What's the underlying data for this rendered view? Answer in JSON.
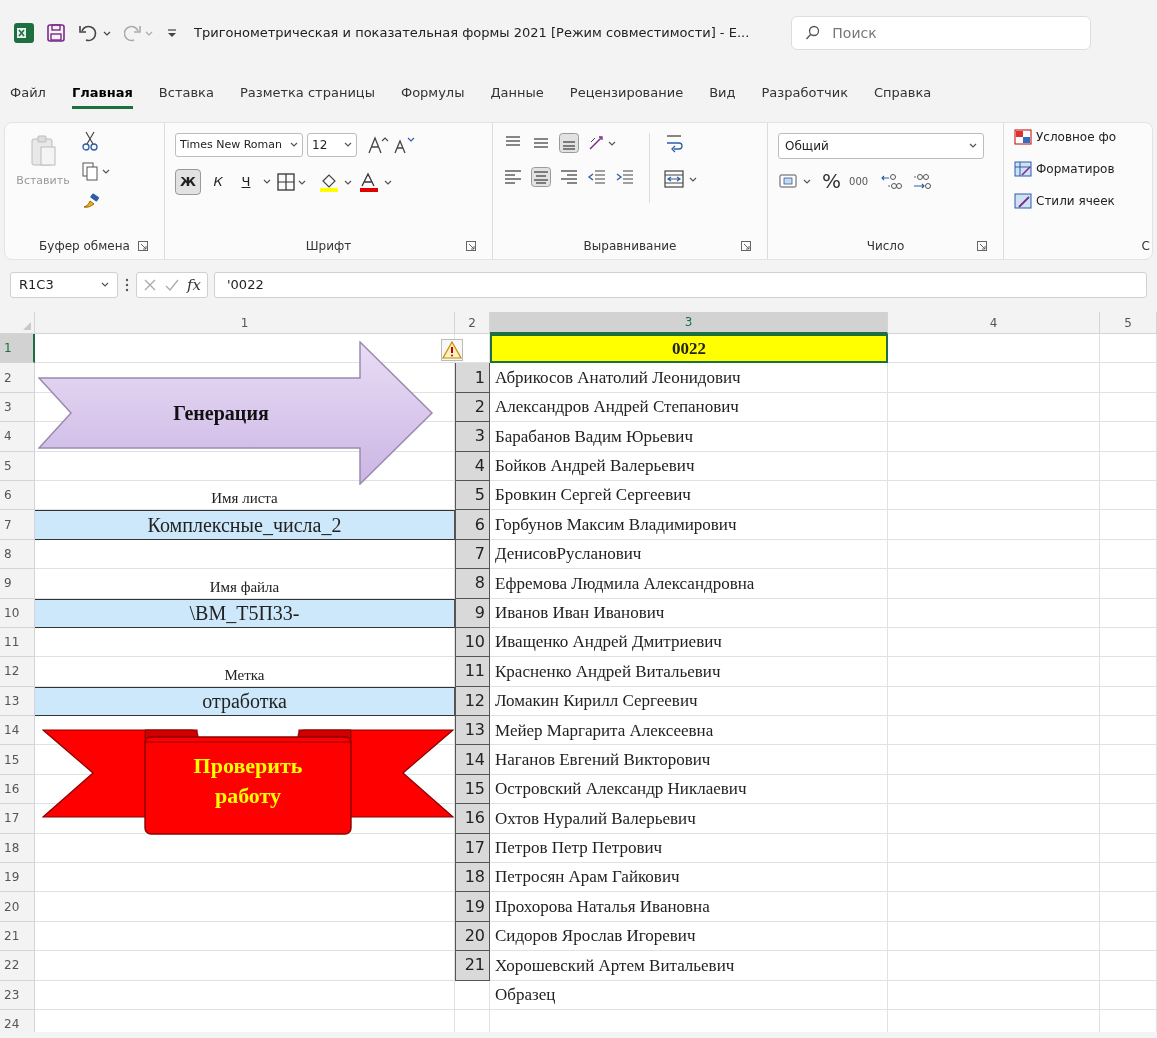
{
  "title_bar": {
    "title": "Тригонометрическая и показательная формы 2021  [Режим совместимости]  -  E...",
    "search_placeholder": "Поиск"
  },
  "ribbon_tabs": [
    {
      "label": "Файл",
      "selected": false
    },
    {
      "label": "Главная",
      "selected": true
    },
    {
      "label": "Вставка",
      "selected": false
    },
    {
      "label": "Разметка страницы",
      "selected": false
    },
    {
      "label": "Формулы",
      "selected": false
    },
    {
      "label": "Данные",
      "selected": false
    },
    {
      "label": "Рецензирование",
      "selected": false
    },
    {
      "label": "Вид",
      "selected": false
    },
    {
      "label": "Разработчик",
      "selected": false
    },
    {
      "label": "Справка",
      "selected": false
    }
  ],
  "ribbon": {
    "paste_label": "Вставить",
    "font_name": "Times New Roman",
    "font_size": "12",
    "bold_label": "Ж",
    "italic_label": "К",
    "underline_label": "Ч",
    "number_format": "Общий",
    "percent_label": "%",
    "thousands_label": "000",
    "style_buttons": [
      "Условное фо",
      "Форматиров",
      "Стили ячеек"
    ],
    "group_labels": [
      "Буфер обмена",
      "Шрифт",
      "Выравнивание",
      "Число",
      "С"
    ]
  },
  "formula_bar": {
    "name_box": "R1C3",
    "fx_label": "fx",
    "formula": "'0022"
  },
  "columns": [
    {
      "label": "1",
      "selected": false
    },
    {
      "label": "2",
      "selected": false
    },
    {
      "label": "3",
      "selected": true
    },
    {
      "label": "4",
      "selected": false
    },
    {
      "label": "5",
      "selected": false
    }
  ],
  "rows": [
    "1",
    "2",
    "3",
    "4",
    "5",
    "6",
    "7",
    "8",
    "9",
    "10",
    "11",
    "12",
    "13",
    "14",
    "15",
    "16",
    "17",
    "18",
    "19",
    "20",
    "21",
    "22",
    "23",
    "24"
  ],
  "form": [
    {
      "kind": "empty"
    },
    {
      "kind": "empty"
    },
    {
      "kind": "empty"
    },
    {
      "kind": "empty"
    },
    {
      "kind": "empty"
    },
    {
      "kind": "label",
      "text": "Имя листа"
    },
    {
      "kind": "value",
      "text": "Комплексные_числа_2"
    },
    {
      "kind": "empty"
    },
    {
      "kind": "label",
      "text": "Имя файла"
    },
    {
      "kind": "value",
      "text": "\\ВМ_Т5П33-"
    },
    {
      "kind": "empty"
    },
    {
      "kind": "label",
      "text": "Метка"
    },
    {
      "kind": "value",
      "text": "отработка"
    }
  ],
  "code_cell": {
    "text": "0022",
    "selected": true
  },
  "students": [
    {
      "number": "1",
      "name": "Абрикосов Анатолий Леонидович"
    },
    {
      "number": "2",
      "name": "Александров Андрей Степанович"
    },
    {
      "number": "3",
      "name": "Барабанов Вадим Юрьевич"
    },
    {
      "number": "4",
      "name": "Бойков Андрей Валерьевич"
    },
    {
      "number": "5",
      "name": "Бровкин Сергей Сергеевич"
    },
    {
      "number": "6",
      "name": "Горбунов Максим Владимирович"
    },
    {
      "number": "7",
      "name": "ДенисовРусланович"
    },
    {
      "number": "8",
      "name": "Ефремова Людмила Александровна"
    },
    {
      "number": "9",
      "name": "Иванов Иван Иванович"
    },
    {
      "number": "10",
      "name": "Иващенко Андрей Дмитриевич"
    },
    {
      "number": "11",
      "name": "Красненко Андрей Витальевич"
    },
    {
      "number": "12",
      "name": "Ломакин Кирилл Сергеевич"
    },
    {
      "number": "13",
      "name": "Мейер Маргарита Алексеевна"
    },
    {
      "number": "14",
      "name": "Наганов Евгений Викторович"
    },
    {
      "number": "15",
      "name": "Островский Александр Никлаевич"
    },
    {
      "number": "16",
      "name": "Охтов Нуралий Валерьевич"
    },
    {
      "number": "17",
      "name": "Петров Петр Петрович"
    },
    {
      "number": "18",
      "name": "Петросян Арам Гайкович"
    },
    {
      "number": "19",
      "name": "Прохорова Наталья Ивановна"
    },
    {
      "number": "20",
      "name": "Сидоров Ярослав Игоревич"
    },
    {
      "number": "21",
      "name": "Хорошевский Артем Витальевич"
    }
  ],
  "sample_label": "Образец",
  "shapes": {
    "generate_button": "Генерация",
    "check_button_lines": [
      "Проверить",
      "работу"
    ]
  }
}
